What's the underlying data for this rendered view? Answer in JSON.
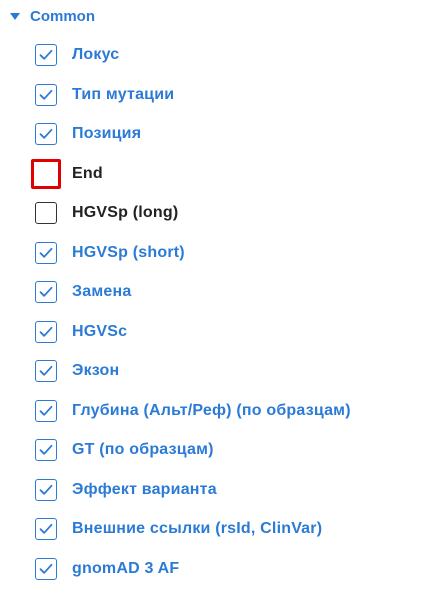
{
  "group": {
    "title": "Common",
    "expanded": true
  },
  "colors": {
    "accent": "#2b7bd6",
    "focus": "#e00000",
    "text_unchecked": "#222222"
  },
  "items": [
    {
      "label": "Локус",
      "checked": true
    },
    {
      "label": "Тип мутации",
      "checked": true
    },
    {
      "label": "Позиция",
      "checked": true
    },
    {
      "label": "End",
      "checked": false,
      "focused": true
    },
    {
      "label": "HGVSp (long)",
      "checked": false
    },
    {
      "label": "HGVSp (short)",
      "checked": true
    },
    {
      "label": "Замена",
      "checked": true
    },
    {
      "label": "HGVSc",
      "checked": true
    },
    {
      "label": "Экзон",
      "checked": true
    },
    {
      "label": "Глубина (Альт/Реф) (по образцам)",
      "checked": true
    },
    {
      "label": "GT (по образцам)",
      "checked": true
    },
    {
      "label": "Эффект варианта",
      "checked": true
    },
    {
      "label": "Внешние ссылки (rsId, ClinVar)",
      "checked": true
    },
    {
      "label": "gnomAD 3 AF",
      "checked": true
    }
  ]
}
